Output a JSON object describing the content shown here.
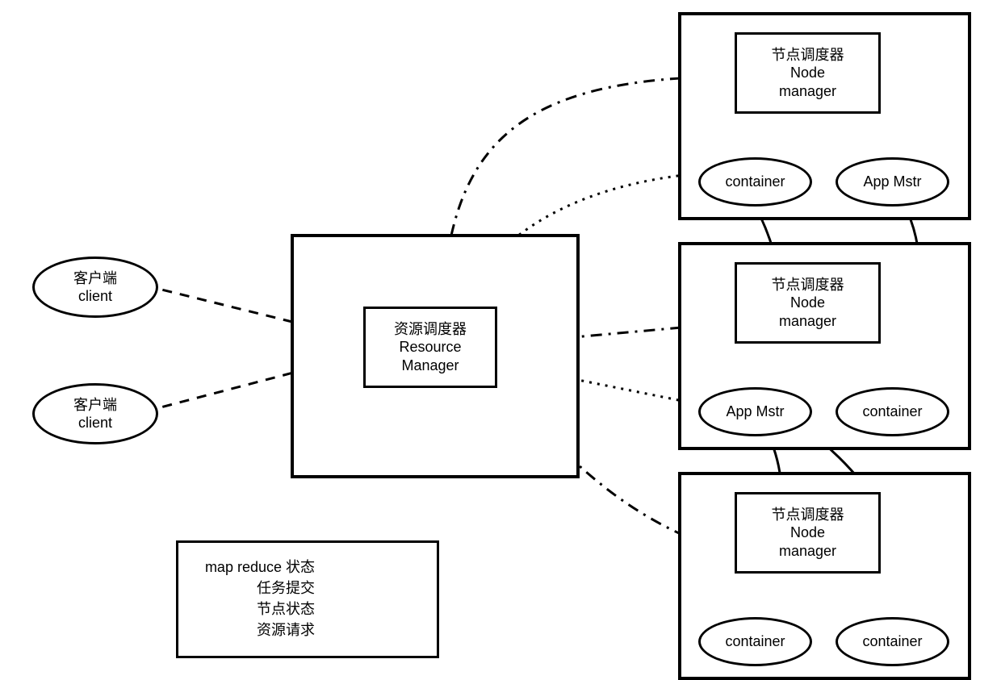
{
  "clients": {
    "c1": "客户端\nclient",
    "c2": "客户端\nclient"
  },
  "rm": "资源调度器\nResource\nManager",
  "nm": "节点调度器\nNode\nmanager",
  "container": "container",
  "appmstr": "App Mstr",
  "legend": {
    "mapreduce": "map reduce 状态",
    "submit": "任务提交",
    "nodestatus": "节点状态",
    "resreq": "资源请求"
  }
}
